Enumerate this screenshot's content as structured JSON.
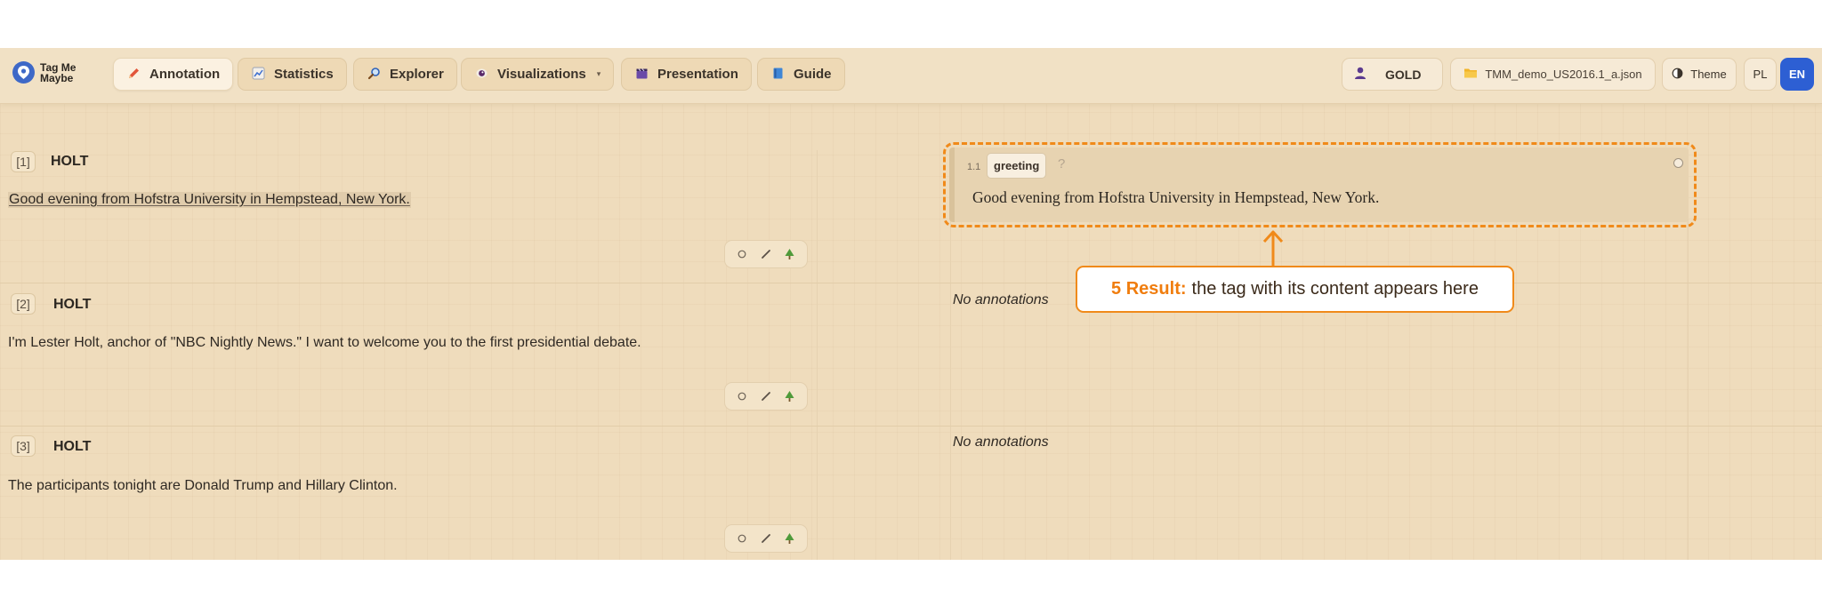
{
  "app": {
    "logo_text": "Tag Me Maybe"
  },
  "nav": [
    {
      "label": "Annotation",
      "icon": "pencil-icon",
      "active": true
    },
    {
      "label": "Statistics",
      "icon": "chart-icon",
      "active": false
    },
    {
      "label": "Explorer",
      "icon": "magnifier-icon",
      "active": false
    },
    {
      "label": "Visualizations",
      "icon": "eye-icon",
      "active": false,
      "dropdown": true
    },
    {
      "label": "Presentation",
      "icon": "clapper-icon",
      "active": false
    },
    {
      "label": "Guide",
      "icon": "book-icon",
      "active": false
    }
  ],
  "toolbar_right": {
    "user_label": "GOLD",
    "file_label": "TMM_demo_US2016.1_a.json",
    "theme_label": "Theme",
    "lang_pl": "PL",
    "lang_en": "EN",
    "active_lang": "EN"
  },
  "segments": [
    {
      "index": "[1]",
      "speaker": "HOLT",
      "text": "Good evening from Hofstra University in Hempstead, New York.",
      "highlighted": true
    },
    {
      "index": "[2]",
      "speaker": "HOLT",
      "text": "I'm Lester Holt, anchor of \"NBC Nightly News.\" I want to welcome you to the first presidential debate.",
      "highlighted": false
    },
    {
      "index": "[3]",
      "speaker": "HOLT",
      "text": "The participants tonight are Donald Trump and Hillary Clinton.",
      "highlighted": false
    }
  ],
  "annotations": {
    "segment1": {
      "index": "1.1",
      "tag": "greeting",
      "help": "?",
      "content": "Good evening from Hofstra University in Hempstead, New York."
    },
    "empty_label": "No annotations"
  },
  "callout": {
    "lead": "5 Result:",
    "text": "the tag with its content appears here"
  },
  "colors": {
    "accent_orange": "#f08a1a",
    "lang_active_blue": "#2d5fd3",
    "background": "#efdcbc"
  }
}
